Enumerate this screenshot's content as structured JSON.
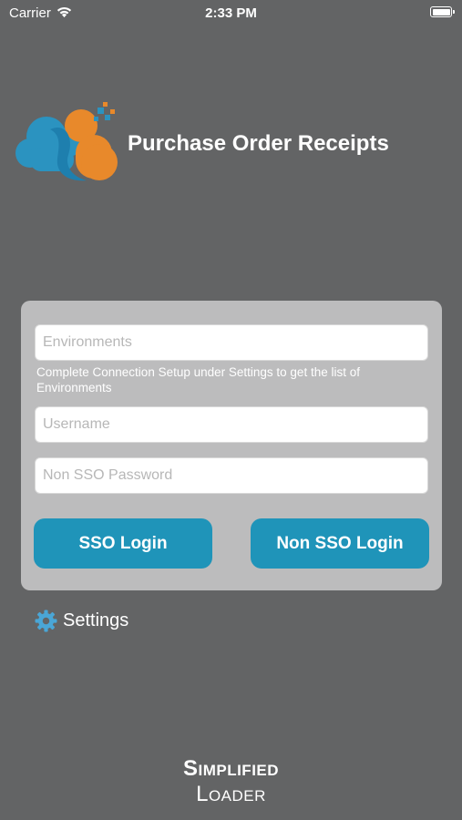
{
  "status_bar": {
    "carrier": "Carrier",
    "time": "2:33 PM"
  },
  "header": {
    "app_title": "Purchase Order Receipts"
  },
  "login": {
    "environments_placeholder": "Environments",
    "environments_hint": "Complete Connection Setup under Settings to get the list of Environments",
    "username_placeholder": "Username",
    "password_placeholder": "Non SSO Password",
    "sso_button": "SSO Login",
    "non_sso_button": "Non SSO Login"
  },
  "settings": {
    "label": "Settings"
  },
  "footer": {
    "line1": "Simplified",
    "line2": "Loader"
  },
  "colors": {
    "background": "#636465",
    "card": "#bcbcbd",
    "button": "#1f94b9",
    "logo_blue": "#2b93c0",
    "logo_orange": "#e8892b"
  }
}
